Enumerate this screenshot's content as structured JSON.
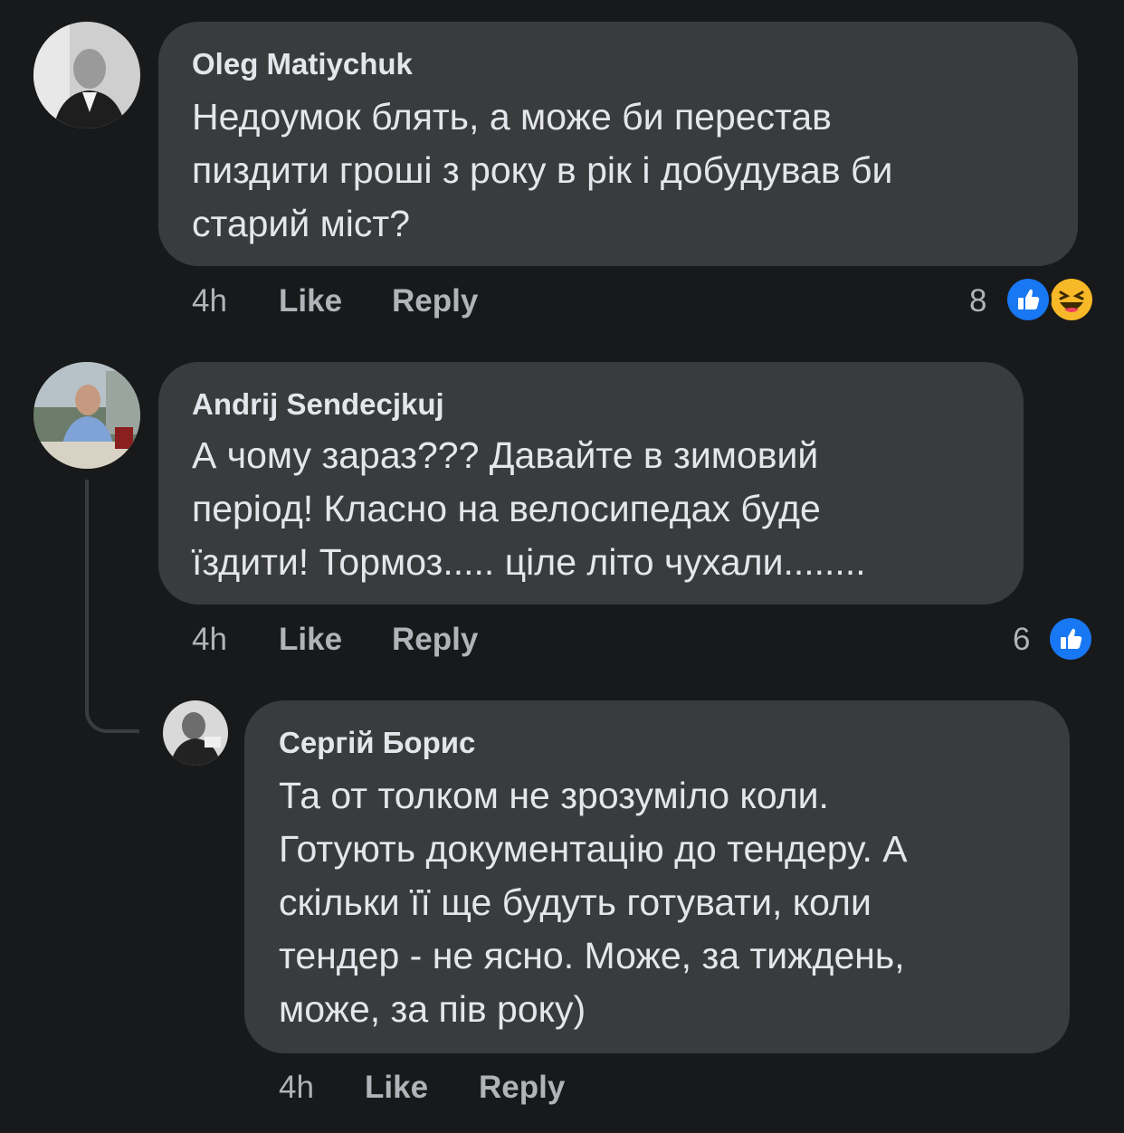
{
  "comments": [
    {
      "author": "Oleg Matiychuk",
      "lines": [
        "Недоумок блять, а може би перестав",
        "пиздити гроші з року в рік і добудував би",
        "старий міст?"
      ],
      "time": "4h",
      "like_label": "Like",
      "reply_label": "Reply",
      "reaction_count": "8",
      "reactions": [
        "like-icon",
        "haha-icon"
      ]
    },
    {
      "author": "Andrij Sendecjkuj",
      "lines": [
        "А чому зараз??? Давайте в зимовий",
        "період! Класно на велосипедах буде",
        "їздити! Тормоз..... ціле літо чухали........"
      ],
      "time": "4h",
      "like_label": "Like",
      "reply_label": "Reply",
      "reaction_count": "6",
      "reactions": [
        "like-icon"
      ]
    },
    {
      "author": "Сергій Борис",
      "lines": [
        "Та от толком не зрозуміло коли.",
        "Готують документацію до тендеру. А",
        "скільки її ще будуть готувати, коли",
        "тендер - не ясно. Може, за тиждень,",
        "може, за пів року)"
      ],
      "time": "4h",
      "like_label": "Like",
      "reply_label": "Reply"
    }
  ],
  "colors": {
    "background": "#18191a",
    "bubble": "#3a3b3c",
    "text": "#e4e6eb",
    "secondary": "#b0b3b8",
    "like_blue": "#1877f2",
    "haha_yellow": "#f7b928"
  }
}
